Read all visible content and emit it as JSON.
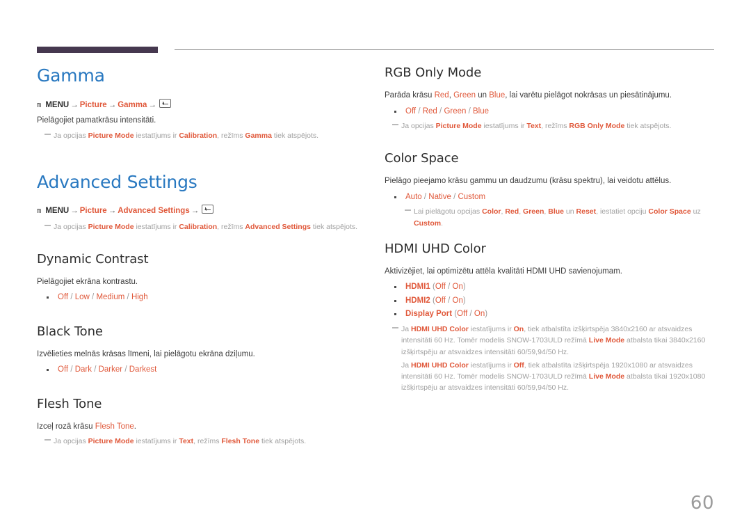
{
  "page": {
    "number": "60",
    "accent_blue": "#2878c0",
    "accent_orange": "#e0583a",
    "header_bar_color": "#46384f",
    "note_gray": "#a0a0a0"
  },
  "left_column": {
    "gamma": {
      "title": "Gamma",
      "menu_path": {
        "key_glyph": "m",
        "menu_label": "MENU",
        "arrow": "→",
        "items": [
          "Picture",
          "Gamma"
        ],
        "enter_icon": "enter-key-icon"
      },
      "description": "Pielāgojiet pamatkrāsu intensitāti.",
      "note": {
        "prefix": "Ja opcijas ",
        "hl1": "Picture Mode",
        "mid1": " iestatījums ir ",
        "hl2": "Calibration",
        "mid2": ", režīms ",
        "hl3": "Gamma",
        "suffix": " tiek atspējots."
      }
    },
    "advanced_settings": {
      "title": "Advanced Settings",
      "menu_path": {
        "key_glyph": "m",
        "menu_label": "MENU",
        "arrow": "→",
        "items": [
          "Picture",
          "Advanced Settings"
        ],
        "enter_icon": "enter-key-icon"
      },
      "note": {
        "prefix": "Ja opcijas ",
        "hl1": "Picture Mode",
        "mid1": " iestatījums ir ",
        "hl2": "Calibration",
        "mid2": ", režīms ",
        "hl3": "Advanced Settings",
        "suffix": " tiek atspējots."
      }
    },
    "dynamic_contrast": {
      "title": "Dynamic Contrast",
      "description": "Pielāgojiet ekrāna kontrastu.",
      "options": [
        "Off",
        "Low",
        "Medium",
        "High"
      ]
    },
    "black_tone": {
      "title": "Black Tone",
      "description": "Izvēlieties melnās krāsas līmeni, lai pielāgotu ekrāna dziļumu.",
      "options": [
        "Off",
        "Dark",
        "Darker",
        "Darkest"
      ]
    },
    "flesh_tone": {
      "title": "Flesh Tone",
      "description_prefix": "Izceļ rozā krāsu ",
      "description_hl": "Flesh Tone",
      "description_suffix": ".",
      "note": {
        "prefix": "Ja opcijas ",
        "hl1": "Picture Mode",
        "mid1": " iestatījums ir ",
        "hl2": "Text",
        "mid2": ", režīms ",
        "hl3": "Flesh Tone",
        "suffix": " tiek atspējots."
      }
    }
  },
  "right_column": {
    "rgb_only_mode": {
      "title": "RGB Only Mode",
      "description_parts": {
        "p1": "Parāda krāsu ",
        "red": "Red",
        "p2": ", ",
        "green": "Green",
        "p3": " un ",
        "blue": "Blue",
        "p4": ", lai varētu pielāgot nokrāsas un piesātinājumu."
      },
      "options": [
        "Off",
        "Red",
        "Green",
        "Blue"
      ],
      "note": {
        "prefix": "Ja opcijas ",
        "hl1": "Picture Mode",
        "mid1": " iestatījums ir ",
        "hl2": "Text",
        "mid2": ", režīms ",
        "hl3": "RGB Only Mode",
        "suffix": " tiek atspējots."
      }
    },
    "color_space": {
      "title": "Color Space",
      "description": "Pielāgo pieejamo krāsu gammu un daudzumu (krāsu spektru), lai veidotu attēlus.",
      "options": [
        "Auto",
        "Native",
        "Custom"
      ],
      "note": {
        "p1": "Lai pielāgotu opcijas ",
        "hl1": "Color",
        "p2": ", ",
        "hl2": "Red",
        "p3": ", ",
        "hl3": "Green",
        "p4": ", ",
        "hl4": "Blue",
        "p5": " un ",
        "hl5": "Reset",
        "p6": ", iestatiet opciju ",
        "hl6": "Color Space",
        "p7": " uz ",
        "hl7": "Custom",
        "p8": "."
      }
    },
    "hdmi_uhd_color": {
      "title": "HDMI UHD Color",
      "description": "Aktivizējiet, lai optimizētu attēla kvalitāti HDMI UHD savienojumam.",
      "options": [
        {
          "label": "HDMI1",
          "values": [
            "Off",
            "On"
          ]
        },
        {
          "label": "HDMI2",
          "values": [
            "Off",
            "On"
          ]
        },
        {
          "label": "Display Port",
          "values": [
            "Off",
            "On"
          ]
        }
      ],
      "note_on": {
        "p1": "Ja ",
        "hl1": "HDMI UHD Color",
        "p2": " iestatījums ir ",
        "hl2": "On",
        "p3": ", tiek atbalstīta izšķirtspēja 3840x2160 ar atsvaidzes intensitāti 60 Hz. Tomēr modelis SNOW-1703ULD režīmā ",
        "hl3": "Live Mode",
        "p4": " atbalsta tikai 3840x2160 izšķirtspēju ar atsvaidzes intensitāti 60/59,94/50 Hz."
      },
      "note_off": {
        "p1": "Ja ",
        "hl1": "HDMI UHD Color",
        "p2": " iestatījums ir ",
        "hl2": "Off",
        "p3": ", tiek atbalstīta izšķirtspēja 1920x1080 ar atsvaidzes intensitāti 60 Hz. Tomēr modelis SNOW-1703ULD režīmā ",
        "hl3": "Live Mode",
        "p4": " atbalsta tikai 1920x1080 izšķirtspēju ar atsvaidzes intensitāti 60/59,94/50 Hz."
      }
    }
  }
}
